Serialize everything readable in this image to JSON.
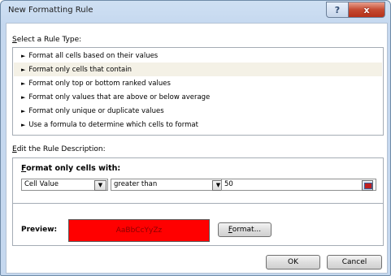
{
  "window": {
    "title": "New Formatting Rule",
    "help_glyph": "?",
    "close_glyph": "x"
  },
  "rule_type": {
    "label": "Select a Rule Type:",
    "items": [
      "Format all cells based on their values",
      "Format only cells that contain",
      "Format only top or bottom ranked values",
      "Format only values that are above or below average",
      "Format only unique or duplicate values",
      "Use a formula to determine which cells to format"
    ],
    "selected_index": 1,
    "bullet": "►"
  },
  "description": {
    "label": "Edit the Rule Description:",
    "heading": "Format only cells with:",
    "condition_type": "Cell Value",
    "operator": "greater than",
    "value": "50",
    "preview_label": "Preview:",
    "preview_text": "AaBbCcYyZz",
    "preview_fill": "#ff0000",
    "format_button": "Format..."
  },
  "buttons": {
    "ok": "OK",
    "cancel": "Cancel"
  }
}
